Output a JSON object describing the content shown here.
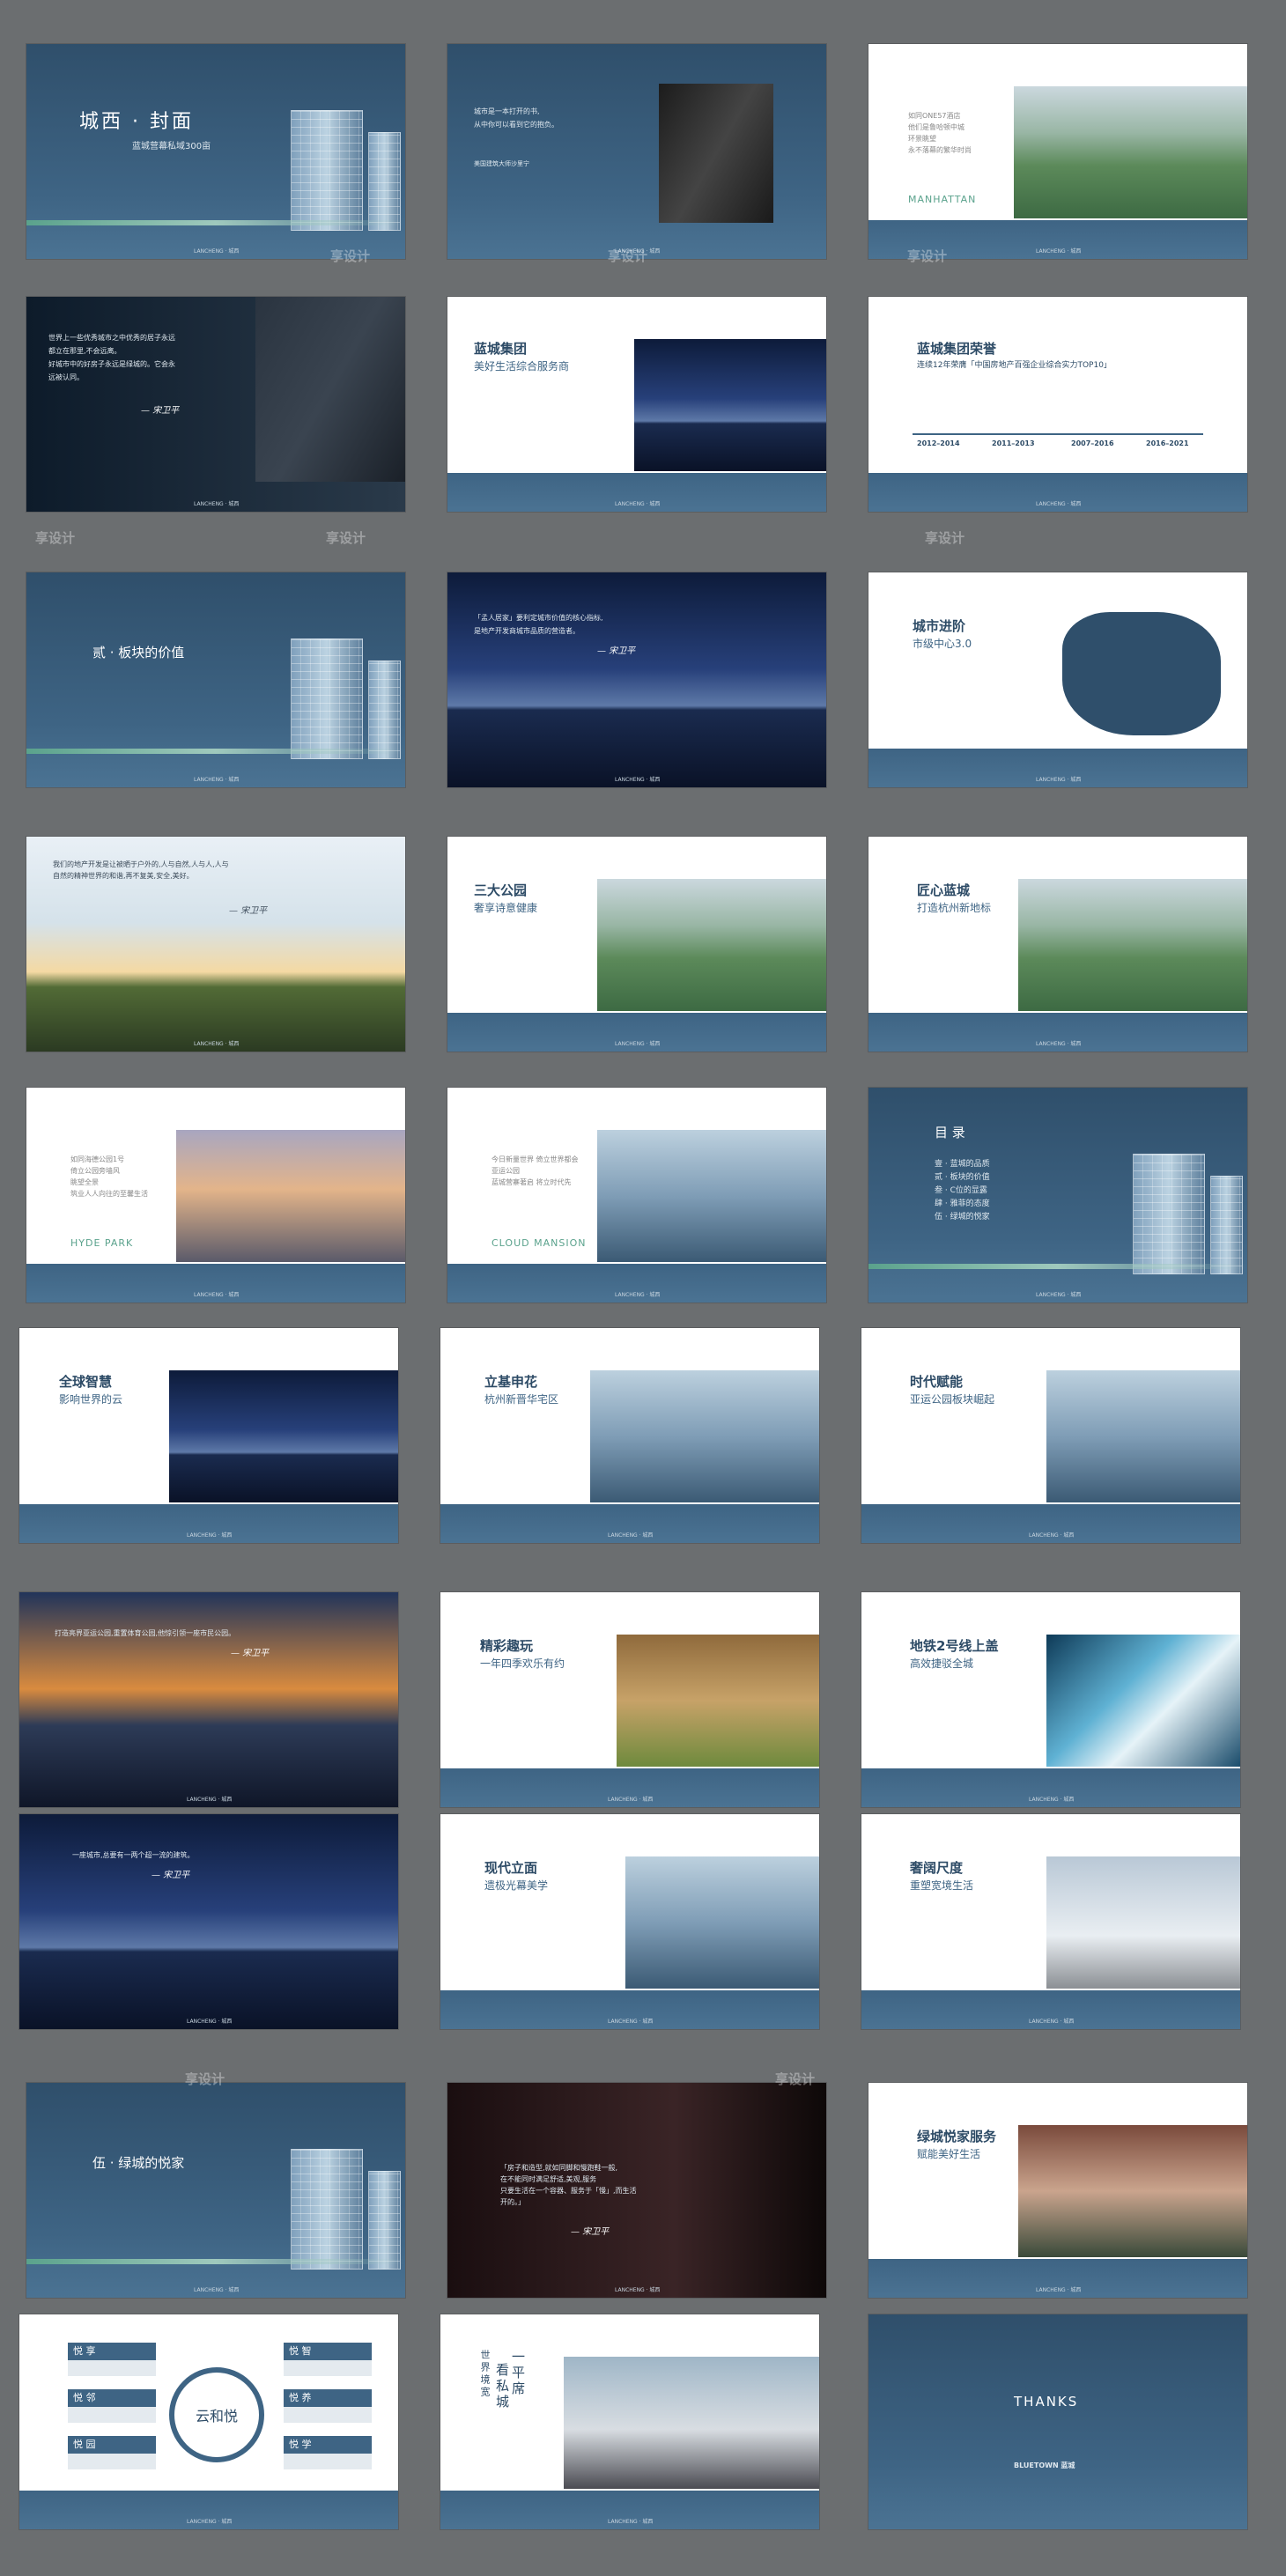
{
  "s1": {
    "title": "城西 · 封面",
    "sub": "蓝城营幕私域300亩"
  },
  "s2": {
    "line1": "城市是一本打开的书,",
    "line2": "从中你可以看到它的抱负。",
    "line3": "美国建筑大师沙里宁"
  },
  "s3": {
    "line1": "如同ONE57酒店",
    "line2": "他们是鲁哈顿中城",
    "line3": "环景眺望",
    "line4": "永不落幕的繁华时尚",
    "en": "MANHATTAN"
  },
  "s4": {
    "line1": "世界上一些优秀城市之中优秀的居子永远",
    "line2": "都立在那里,不会远离。",
    "line3": "好城市中的好房子永远是绿城的。它会永",
    "line4": "远被认同。",
    "sig": "— 宋卫平"
  },
  "s5": {
    "title": "蓝城集团",
    "sub": "美好生活综合服务商"
  },
  "s6": {
    "title": "蓝城集团荣誉",
    "line": "连续12年荣膺「中国房地产百强企业综合实力TOP10」",
    "years": [
      "2012–2014",
      "2011–2013",
      "2007–2016",
      "2016–2021"
    ]
  },
  "s7": {
    "title": "贰 · 板块的价值"
  },
  "s8": {
    "line1": "「孟人居家」要利定城市价值的核心指标,",
    "line2": "是地产开发商城市品质的营造者。",
    "sig": "— 宋卫平"
  },
  "s9": {
    "title": "城市进阶",
    "sub": "市级中心3.0"
  },
  "s10": {
    "line1": "我们的地产开发是让被晒于户外的,人与自然,人与人,人与",
    "line2": "自然的精神世界的和谐,再不复美,安全,美好。",
    "sig": "— 宋卫平"
  },
  "s11": {
    "title": "三大公园",
    "sub": "奢享诗意健康"
  },
  "s12": {
    "title": "匠心蓝城",
    "sub": "打造杭州新地标"
  },
  "s13": {
    "line1": "如同海德公园1号",
    "line2": "倚立公园旁墙风",
    "line3": "眺望全景",
    "line4": "筑业人人向往的至馨生活",
    "en": "HYDE PARK"
  },
  "s14": {
    "line1": "今日新量世界 倚立世界都会",
    "line2": "亚运公园",
    "line3": "蓝城营寨著启 将立时代先",
    "en": "CLOUD MANSION"
  },
  "s15": {
    "title": "目  录",
    "items": [
      "壹 · 蓝城的品质",
      "贰 · 板块的价值",
      "叁 · C位的显露",
      "肆 · 雅菲的态度",
      "伍 · 绿城的悦家"
    ]
  },
  "s16": {
    "title": "全球智慧",
    "sub": "影响世界的云"
  },
  "s17": {
    "title": "立基申花",
    "sub": "杭州新晋华宅区"
  },
  "s18": {
    "title": "时代赋能",
    "sub": "亚运公园板块崛起"
  },
  "s19": {
    "line": "打造亮界亚运公园,重置体育公园,他惊引领一座市民公园。",
    "sig": "— 宋卫平"
  },
  "s20": {
    "title": "精彩趣玩",
    "sub": "一年四季欢乐有约"
  },
  "s21": {
    "title": "地铁2号线上盖",
    "sub": "高效捷驳全城"
  },
  "s22": {
    "line": "一座城市,总要有一两个超一流的建筑。",
    "sig": "— 宋卫平"
  },
  "s23": {
    "title": "现代立面",
    "sub": "遗极光幕美学"
  },
  "s24": {
    "title": "奢阔尺度",
    "sub": "重塑宽境生活"
  },
  "s25": {
    "title": "伍 · 绿城的悦家"
  },
  "s26": {
    "line1": "「房子和造型,就如同脚和慢跑鞋一般,",
    "line2": "在不能同时满足舒适,美观,服务",
    "line3": "只要生活在一个容器、服务于「慢」,而生活",
    "line4": "开的。」",
    "sig": "— 宋卫平"
  },
  "s27": {
    "title": "绿城悦家服务",
    "sub": "赋能美好生活"
  },
  "s28": {
    "left": [
      "悦 享",
      "悦 邻",
      "悦 园"
    ],
    "right": [
      "悦 智",
      "悦 养",
      "悦 学"
    ],
    "center": "云和悦"
  },
  "s29": {
    "vert1": "一平席",
    "vert2": "看私城",
    "vert3": "世界境宽"
  },
  "s30": {
    "thanks": "THANKS",
    "brand": "BLUETOWN 蓝城"
  },
  "foot": "LANCHENG · 城西",
  "wm": "享设计"
}
